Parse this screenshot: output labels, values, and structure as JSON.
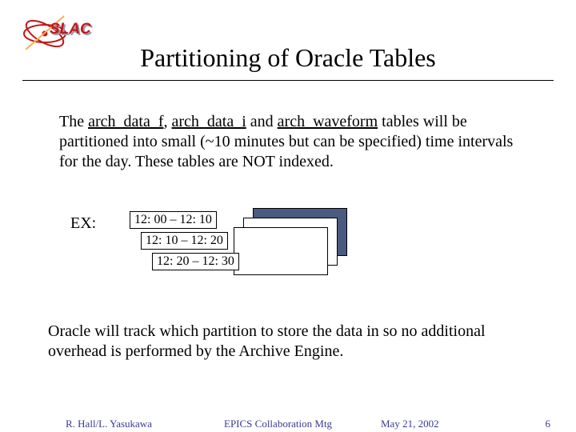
{
  "title": "Partitioning of Oracle Tables",
  "body1_html": "The <span class='u'>arch_data_f</span>, <span class='u'>arch_data_i</span> and <span class='u'>arch_waveform</span> tables will be partitioned into small (~10 minutes but can be specified) time intervals for the day. These tables are NOT indexed.",
  "ex_label": "EX:",
  "intervals": {
    "i1": "12: 00 – 12: 10",
    "i2": "12: 10 – 12: 20",
    "i3": "12: 20 – 12: 30"
  },
  "body2": "Oracle will track which partition to store the data in so no additional overhead is performed by the Archive Engine.",
  "footer": {
    "authors": "R. Hall/L. Yasukawa",
    "meeting": "EPICS Collaboration Mtg",
    "date": "May 21, 2002",
    "page": "6"
  },
  "logo_colors": {
    "red": "#c01818",
    "gray": "#9a9ab0"
  }
}
